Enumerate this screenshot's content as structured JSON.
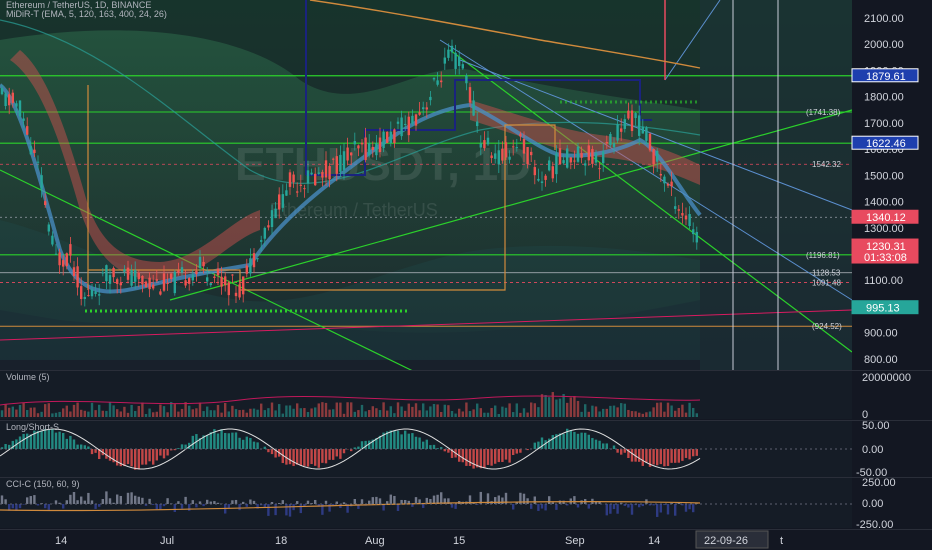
{
  "header": {
    "symbol_line": "Ethereum / TetherUS, 1D, BINANCE",
    "indicator_line": "MiDiR-T (EMA, 5, 120, 163, 400, 24, 26)"
  },
  "watermark": {
    "symbol": "ETHUSDT, 1D",
    "name": "Ethereum / TetherUS"
  },
  "price_axis": {
    "ticks": [
      "2100.00",
      "2000.00",
      "1900.00",
      "1800.00",
      "1700.00",
      "1600.00",
      "1500.00",
      "1400.00",
      "1300.00",
      "1200.00",
      "1100.00",
      "1000.00",
      "900.00",
      "800.00"
    ],
    "tick_values": [
      2100,
      2000,
      1900,
      1800,
      1700,
      1600,
      1500,
      1400,
      1300,
      1200,
      1100,
      1000,
      900,
      800
    ],
    "range": [
      780,
      2160
    ]
  },
  "price_tags": [
    {
      "text": "1879.61",
      "value": 1879.61,
      "color": "#1e3fae",
      "border": "#ffffff"
    },
    {
      "text": "1622.46",
      "value": 1622.46,
      "color": "#1e3fae",
      "border": "#ffffff"
    },
    {
      "text": "1340.12",
      "value": 1340.12,
      "color": "#e84a5f",
      "border": "#e84a5f"
    },
    {
      "text": "1230.31",
      "value": 1230.31,
      "color": "#e84a5f",
      "border": "#e84a5f"
    },
    {
      "text": "995.13",
      "value": 995.13,
      "color": "#26a69a",
      "border": "#26a69a"
    }
  ],
  "countdown": "01:33:08",
  "level_notes": [
    {
      "text": "(1741.38)",
      "value": 1741.38
    },
    {
      "text": "1542.32",
      "value": 1542.32
    },
    {
      "text": "(1196.81)",
      "value": 1196.81
    },
    {
      "text": "1128.53",
      "value": 1128.53
    },
    {
      "text": "1091.48",
      "value": 1091.48
    },
    {
      "text": "(924.52)",
      "value": 924.52
    }
  ],
  "volume_pane": {
    "label": "Volume (5)",
    "ticks": [
      "20000000",
      "0"
    ]
  },
  "longshort_pane": {
    "label": "Long/Short-S",
    "ticks": [
      "50.00",
      "0.00",
      "-50.00"
    ]
  },
  "cci_pane": {
    "label": "CCI-C (150, 60, 9)",
    "ticks": [
      "250.00",
      "0.00",
      "-250.00"
    ]
  },
  "time_axis": {
    "labels": [
      "14",
      "Jul",
      "18",
      "Aug",
      "15",
      "Sep",
      "14"
    ],
    "cursor_label": "22-09-26",
    "trailing": "t"
  },
  "colors": {
    "background": "#131722",
    "up": "#26a69a",
    "down": "#ef5350",
    "green_line": "#2bd12b",
    "navy_line": "#1a237e",
    "orange_line": "#d08a3c",
    "blue_ma": "#4a8fc7",
    "red_band": "#c0392b"
  }
}
